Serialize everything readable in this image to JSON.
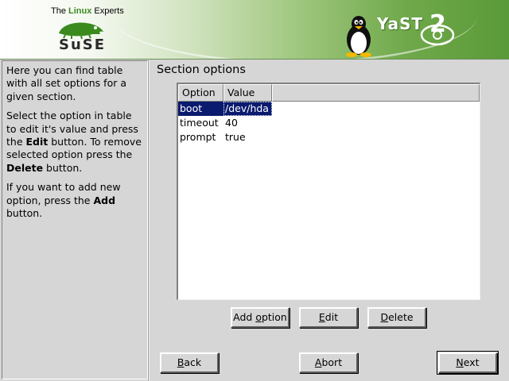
{
  "header": {
    "tagline_pre": "The ",
    "tagline_linux": "Linux",
    "tagline_post": " Experts",
    "suse_logo_text": "SuSE",
    "yast_text": "YaST",
    "yast_number": "2"
  },
  "help": {
    "para1": "Here you can find table with all set options for a given section.",
    "para2_a": "Select the option in table to edit it's value and press the ",
    "para2_edit": "Edit",
    "para2_b": " button. To remove selected option press the ",
    "para2_delete": "Delete",
    "para2_c": " button.",
    "para3_a": "If you want to add new option, press the ",
    "para3_add": "Add",
    "para3_b": " button."
  },
  "main": {
    "section_title": "Section options",
    "columns": [
      "Option",
      "Value"
    ],
    "rows": [
      {
        "option": "boot",
        "value": "/dev/hda",
        "selected": true
      },
      {
        "option": "timeout",
        "value": "40",
        "selected": false
      },
      {
        "option": "prompt",
        "value": "true",
        "selected": false
      }
    ]
  },
  "buttons": {
    "add_pre": "Add ",
    "add_u": "o",
    "add_post": "ption",
    "edit_u": "E",
    "edit_post": "dit",
    "delete_u": "D",
    "delete_post": "elete",
    "back_u": "B",
    "back_post": "ack",
    "abort_u": "A",
    "abort_post": "bort",
    "next_u": "N",
    "next_post": "ext"
  },
  "colors": {
    "selection": "#0a1a6e",
    "brand_green": "#3a8a1e"
  }
}
